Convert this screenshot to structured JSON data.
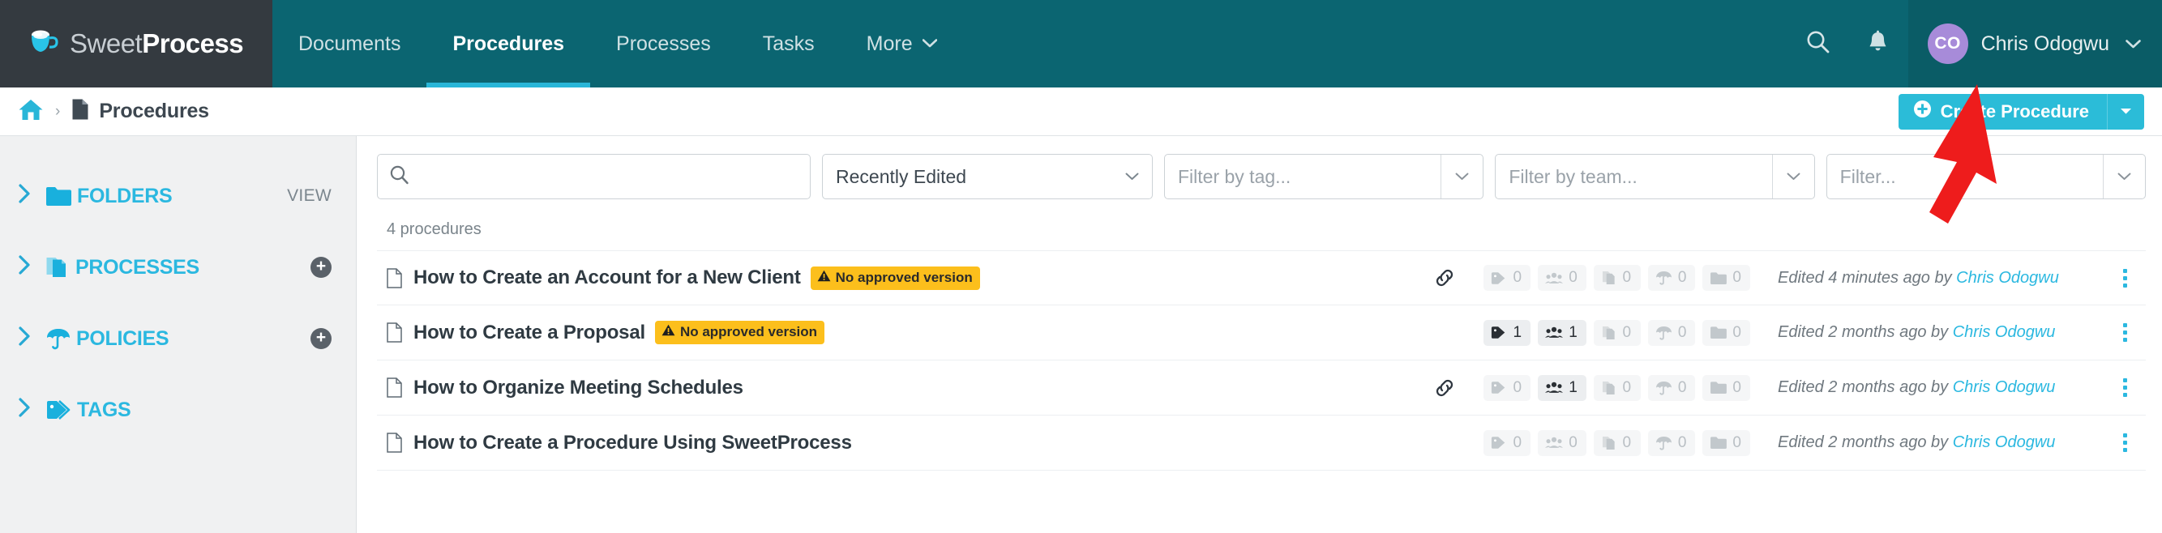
{
  "brand": {
    "name_light": "Sweet",
    "name_bold": "Process",
    "logo_icon": "coffee-cup-icon"
  },
  "topnav": {
    "items": [
      {
        "label": "Documents",
        "active": false
      },
      {
        "label": "Procedures",
        "active": true
      },
      {
        "label": "Processes",
        "active": false
      },
      {
        "label": "Tasks",
        "active": false
      },
      {
        "label": "More",
        "active": false,
        "caret": "⌄"
      }
    ],
    "search_icon": "search-icon",
    "bell_icon": "bell-icon",
    "user": {
      "initials": "CO",
      "name": "Chris Odogwu",
      "caret": "⌄",
      "avatar_color": "#a78bd9"
    }
  },
  "breadcrumb": {
    "home_icon": "home-icon",
    "separator": "›",
    "page_icon": "document-icon",
    "page_label": "Procedures"
  },
  "create": {
    "plus_icon": "plus-circle-icon",
    "label": "Create Procedure",
    "caret": "▾",
    "color": "#2bbcd8"
  },
  "sidebar": {
    "items": [
      {
        "label": "FOLDERS",
        "icon": "folder-icon",
        "chevron": "❯",
        "right": "view",
        "right_label": "VIEW"
      },
      {
        "label": "PROCESSES",
        "icon": "processes-icon",
        "chevron": "❯",
        "right": "plus",
        "right_label": "+"
      },
      {
        "label": "POLICIES",
        "icon": "umbrella-icon",
        "chevron": "❯",
        "right": "plus",
        "right_label": "+"
      },
      {
        "label": "TAGS",
        "icon": "tag-icon",
        "chevron": "❯",
        "right": "none",
        "right_label": ""
      }
    ]
  },
  "filters": {
    "search": {
      "icon": "search-icon",
      "value": "",
      "placeholder": ""
    },
    "sort": {
      "value": "Recently Edited",
      "chevron": "⌄"
    },
    "tag": {
      "placeholder": "Filter by tag...",
      "chevron": "⌄"
    },
    "team": {
      "placeholder": "Filter by team...",
      "chevron": "⌄"
    },
    "extra": {
      "placeholder": "Filter...",
      "chevron": "⌄"
    }
  },
  "list": {
    "count_label": "4 procedures",
    "warning_badge_text": "No approved version",
    "warning_icon": "warning-triangle-icon",
    "link_icon": "link-icon",
    "kebab_icon": "kebab-menu-icon",
    "doc_icon": "document-icon",
    "stat_icons": [
      "tag-icon",
      "team-icon",
      "processes-icon",
      "umbrella-icon",
      "folder-icon"
    ],
    "rows": [
      {
        "title": "How to Create an Account for a New Client",
        "warning": true,
        "has_link": true,
        "stats": [
          {
            "icon": "tag-icon",
            "value": "0",
            "on": false
          },
          {
            "icon": "team-icon",
            "value": "0",
            "on": false
          },
          {
            "icon": "processes-icon",
            "value": "0",
            "on": false
          },
          {
            "icon": "umbrella-icon",
            "value": "0",
            "on": false
          },
          {
            "icon": "folder-icon",
            "value": "0",
            "on": false
          }
        ],
        "edited_prefix": "Edited 4 minutes ago by ",
        "edited_author": "Chris Odogwu"
      },
      {
        "title": "How to Create a Proposal",
        "warning": true,
        "has_link": false,
        "stats": [
          {
            "icon": "tag-icon",
            "value": "1",
            "on": true
          },
          {
            "icon": "team-icon",
            "value": "1",
            "on": true
          },
          {
            "icon": "processes-icon",
            "value": "0",
            "on": false
          },
          {
            "icon": "umbrella-icon",
            "value": "0",
            "on": false
          },
          {
            "icon": "folder-icon",
            "value": "0",
            "on": false
          }
        ],
        "edited_prefix": "Edited 2 months ago by ",
        "edited_author": "Chris Odogwu"
      },
      {
        "title": "How to Organize Meeting Schedules",
        "warning": false,
        "has_link": true,
        "stats": [
          {
            "icon": "tag-icon",
            "value": "0",
            "on": false
          },
          {
            "icon": "team-icon",
            "value": "1",
            "on": true
          },
          {
            "icon": "processes-icon",
            "value": "0",
            "on": false
          },
          {
            "icon": "umbrella-icon",
            "value": "0",
            "on": false
          },
          {
            "icon": "folder-icon",
            "value": "0",
            "on": false
          }
        ],
        "edited_prefix": "Edited 2 months ago by ",
        "edited_author": "Chris Odogwu"
      },
      {
        "title": "How to Create a Procedure Using SweetProcess",
        "warning": false,
        "has_link": false,
        "stats": [
          {
            "icon": "tag-icon",
            "value": "0",
            "on": false
          },
          {
            "icon": "team-icon",
            "value": "0",
            "on": false
          },
          {
            "icon": "processes-icon",
            "value": "0",
            "on": false
          },
          {
            "icon": "umbrella-icon",
            "value": "0",
            "on": false
          },
          {
            "icon": "folder-icon",
            "value": "0",
            "on": false
          }
        ],
        "edited_prefix": "Edited 2 months ago by ",
        "edited_author": "Chris Odogwu"
      }
    ]
  },
  "annotation": {
    "arrow_color": "#ee1c1c",
    "arrow_points": "from (1335,170) to (1432,108)"
  }
}
